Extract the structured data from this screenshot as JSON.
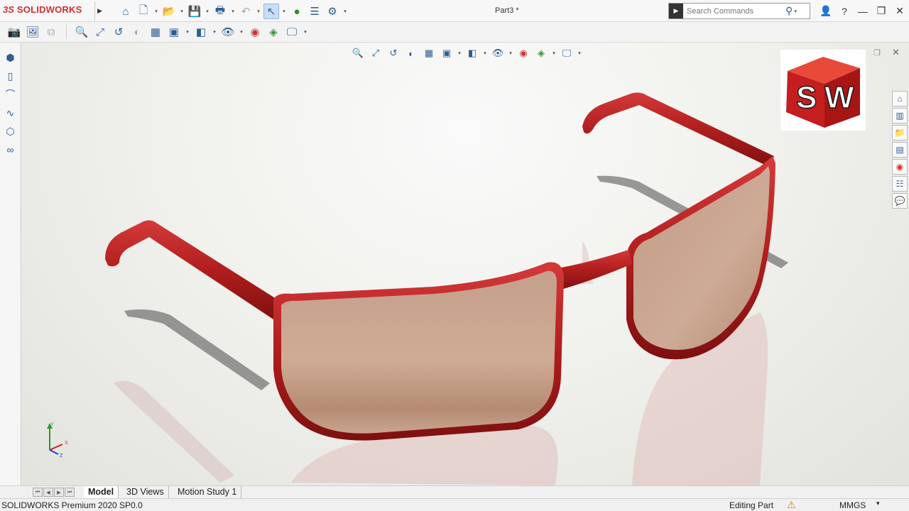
{
  "app": {
    "brand_prefix": "3S",
    "brand_name": "SOLIDWORKS",
    "document_title": "Part3 *"
  },
  "search": {
    "placeholder": "Search Commands"
  },
  "window_controls": {
    "user": "👤",
    "help": "?",
    "minimize": "—",
    "restore": "❐",
    "close": "✕"
  },
  "viewport": {
    "restore_label": "❐",
    "close_label": "✕",
    "badge_text": "SW"
  },
  "triad": {
    "x_label": "X",
    "y_label": "Y",
    "z_label": "Z"
  },
  "tabs": [
    {
      "label": "Model",
      "active": true
    },
    {
      "label": "3D Views",
      "active": false
    },
    {
      "label": "Motion Study 1",
      "active": false
    }
  ],
  "status": {
    "product": "SOLIDWORKS Premium 2020 SP0.0",
    "mode": "Editing Part",
    "units": "MMGS",
    "units_dropdown": "▾"
  },
  "colors": {
    "brand_red": "#d32f2f",
    "frame_red": "#b31f1f",
    "lens": "#c9a08a",
    "icon_blue": "#2d5d95"
  }
}
